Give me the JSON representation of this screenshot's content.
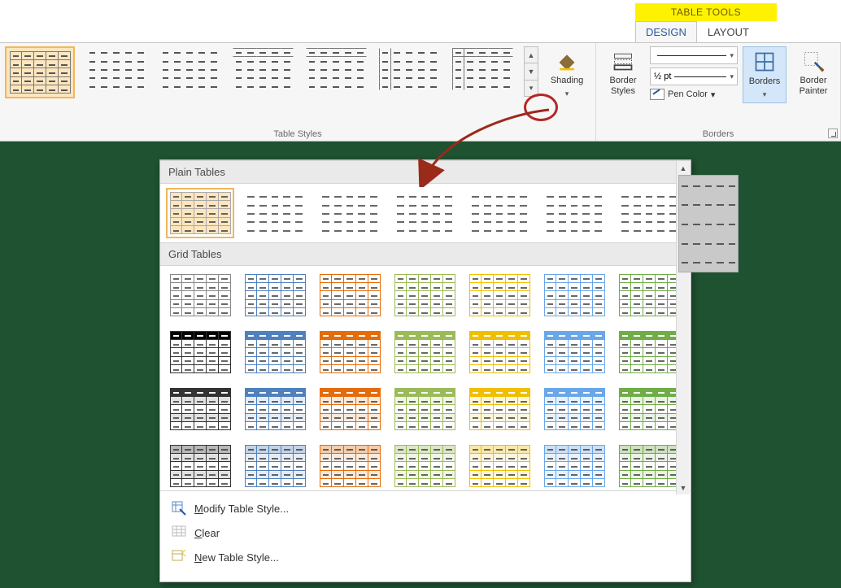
{
  "context_tab_title": "TABLE TOOLS",
  "tabs": {
    "design": "DESIGN",
    "layout": "LAYOUT"
  },
  "ribbon": {
    "groups": {
      "table_styles": {
        "label": "Table Styles"
      },
      "borders": {
        "label": "Borders"
      }
    },
    "shading_label": "Shading",
    "border_styles_label": "Border\nStyles",
    "line_weight_value": "½ pt",
    "pen_color_label": "Pen Color",
    "borders_btn_label": "Borders",
    "border_painter_label": "Border\nPainter"
  },
  "gallery": {
    "categories": {
      "plain": "Plain Tables",
      "grid": "Grid Tables"
    },
    "grid_colors": [
      "#333333",
      "#4f81bd",
      "#e46c0a",
      "#9bbb59",
      "#f0c000",
      "#6aa7e8",
      "#70ad47"
    ],
    "menu": {
      "modify": "Modify Table Style...",
      "clear": "Clear",
      "new": "New Table Style..."
    }
  }
}
